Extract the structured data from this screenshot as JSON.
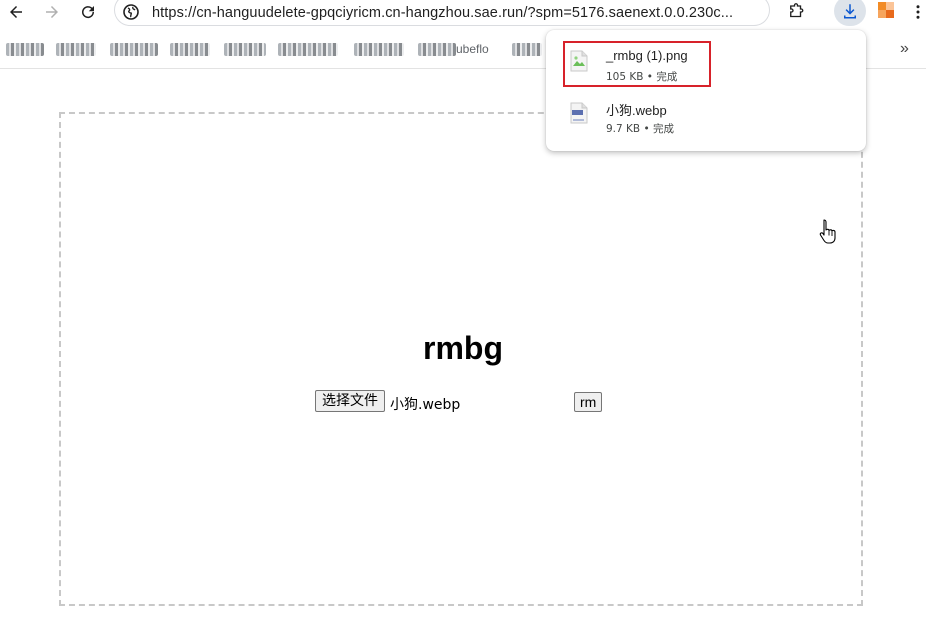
{
  "browser": {
    "url": "https://cn-hanguudelete-gpqciyricm.cn-hangzhou.sae.run/?spm=5176.saenext.0.0.230c...",
    "bookmarks_visible_fragment": "ubeflo",
    "bookmarks_more": "»"
  },
  "page": {
    "title": "rmbg",
    "file_button_label": "选择文件",
    "selected_file": "小狗.webp",
    "rm_button_label": "rm"
  },
  "downloads": {
    "items": [
      {
        "name": "_rmbg (1).png",
        "size": "105 KB",
        "status": "完成",
        "meta": "105 KB • 完成",
        "icon": "png-file-icon"
      },
      {
        "name": "小狗.webp",
        "size": "9.7 KB",
        "status": "完成",
        "meta": "9.7 KB • 完成",
        "icon": "webp-file-icon"
      }
    ]
  },
  "colors": {
    "highlight": "#d7222a",
    "download_button_bg": "#dde3ea",
    "download_icon": "#0b57d0"
  }
}
